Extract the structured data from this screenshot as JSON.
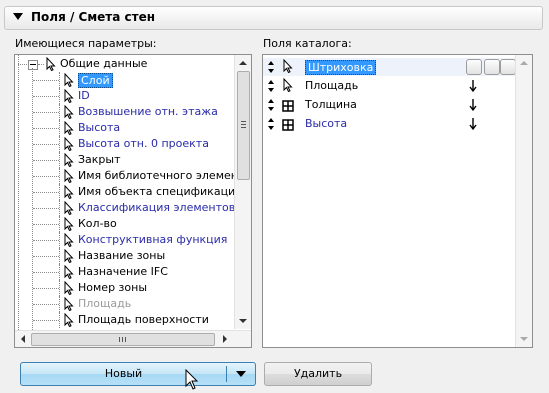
{
  "header": {
    "title": "Поля / Смета стен"
  },
  "available": {
    "label": "Имеющиеся параметры:",
    "root": "Общие данные",
    "items": [
      {
        "text": "Слой",
        "style": "selected"
      },
      {
        "text": "ID",
        "style": "blue"
      },
      {
        "text": "Возвышение отн. этажа",
        "style": "blue"
      },
      {
        "text": "Высота",
        "style": "blue"
      },
      {
        "text": "Высота отн. 0 проекта",
        "style": "blue"
      },
      {
        "text": "Закрыт",
        "style": "normal"
      },
      {
        "text": "Имя библиотечного элемента",
        "style": "normal"
      },
      {
        "text": "Имя объекта спецификации",
        "style": "normal"
      },
      {
        "text": "Классификация элементов",
        "style": "blue"
      },
      {
        "text": "Кол-во",
        "style": "normal"
      },
      {
        "text": "Конструктивная функция",
        "style": "blue"
      },
      {
        "text": "Название зоны",
        "style": "normal"
      },
      {
        "text": "Назначение IFC",
        "style": "normal"
      },
      {
        "text": "Номер зоны",
        "style": "normal"
      },
      {
        "text": "Площадь",
        "style": "gray"
      },
      {
        "text": "Площадь поверхности",
        "style": "normal"
      }
    ]
  },
  "catalog": {
    "label": "Поля каталога:",
    "items": [
      {
        "text": "Штриховка",
        "icon": "cursor-icon",
        "style": "selected"
      },
      {
        "text": "Площадь",
        "icon": "cursor-icon",
        "style": "normal"
      },
      {
        "text": "Толщина",
        "icon": "grid-icon",
        "style": "normal"
      },
      {
        "text": "Высота",
        "icon": "grid-icon",
        "style": "blue"
      }
    ]
  },
  "buttons": {
    "new_label": "Новый",
    "delete_label": "Удалить"
  },
  "colors": {
    "accent": "#3399ff",
    "blue_text": "#2a2aa8",
    "gray_text": "#9a9a9a"
  }
}
